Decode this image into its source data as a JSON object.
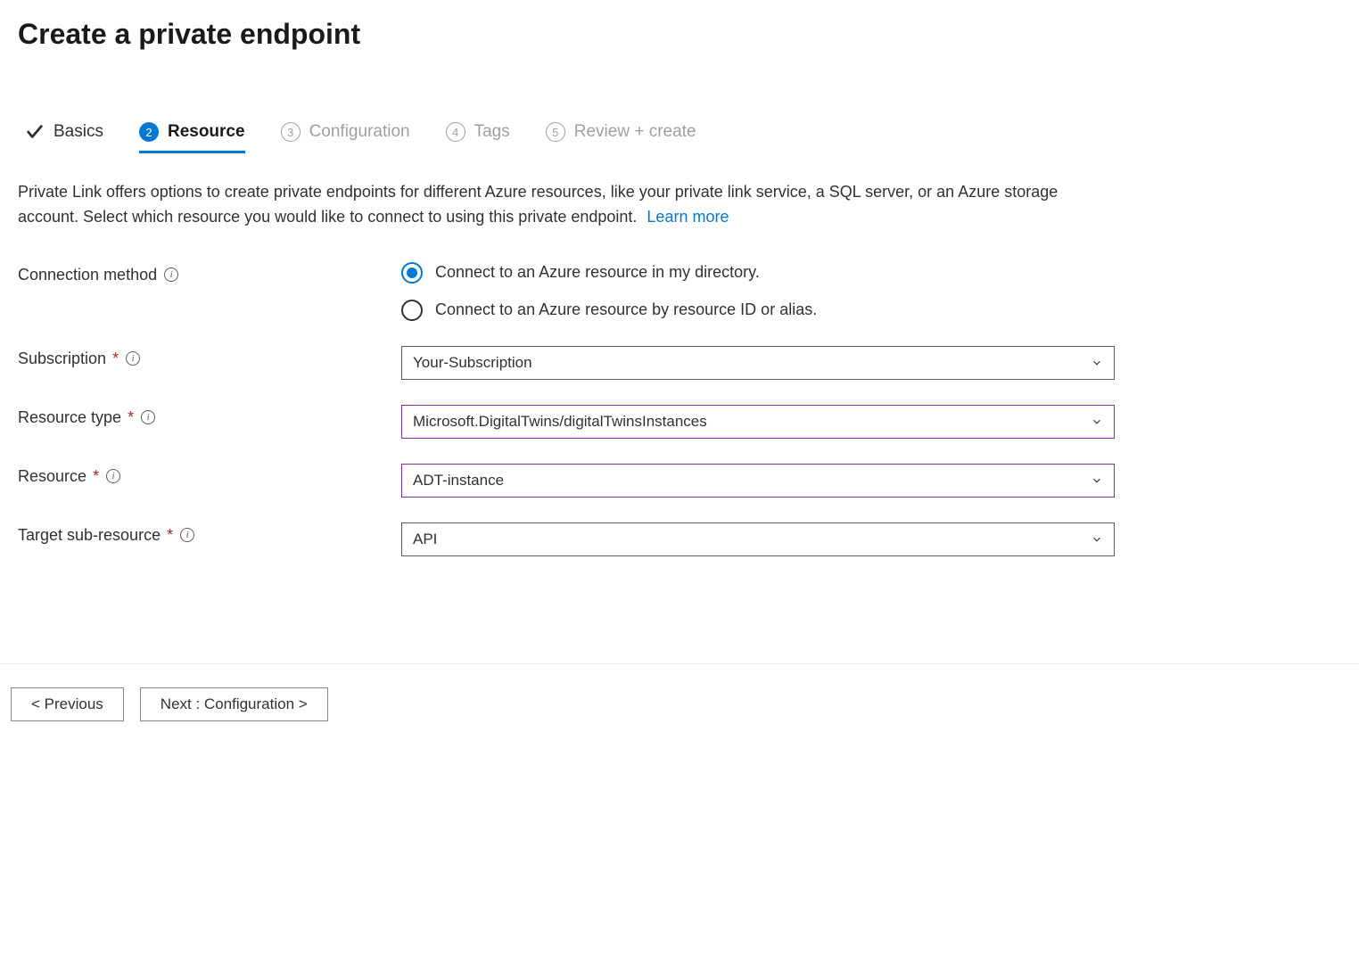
{
  "header": {
    "title": "Create a private endpoint"
  },
  "tabs": [
    {
      "label": "Basics",
      "state": "complete"
    },
    {
      "label": "Resource",
      "number": "2",
      "state": "active"
    },
    {
      "label": "Configuration",
      "number": "3",
      "state": "pending"
    },
    {
      "label": "Tags",
      "number": "4",
      "state": "pending"
    },
    {
      "label": "Review + create",
      "number": "5",
      "state": "pending"
    }
  ],
  "description": {
    "text": "Private Link offers options to create private endpoints for different Azure resources, like your private link service, a SQL server, or an Azure storage account. Select which resource you would like to connect to using this private endpoint.",
    "learn_more": "Learn more"
  },
  "form": {
    "connection_method": {
      "label": "Connection method",
      "options": [
        {
          "label": "Connect to an Azure resource in my directory.",
          "selected": true
        },
        {
          "label": "Connect to an Azure resource by resource ID or alias.",
          "selected": false
        }
      ]
    },
    "subscription": {
      "label": "Subscription",
      "required": true,
      "value": "Your-Subscription"
    },
    "resource_type": {
      "label": "Resource type",
      "required": true,
      "value": "Microsoft.DigitalTwins/digitalTwinsInstances",
      "highlight": true
    },
    "resource": {
      "label": "Resource",
      "required": true,
      "value": "ADT-instance",
      "highlight": true
    },
    "target_sub_resource": {
      "label": "Target sub-resource",
      "required": true,
      "value": "API"
    }
  },
  "footer": {
    "previous": "< Previous",
    "next": "Next : Configuration >"
  }
}
